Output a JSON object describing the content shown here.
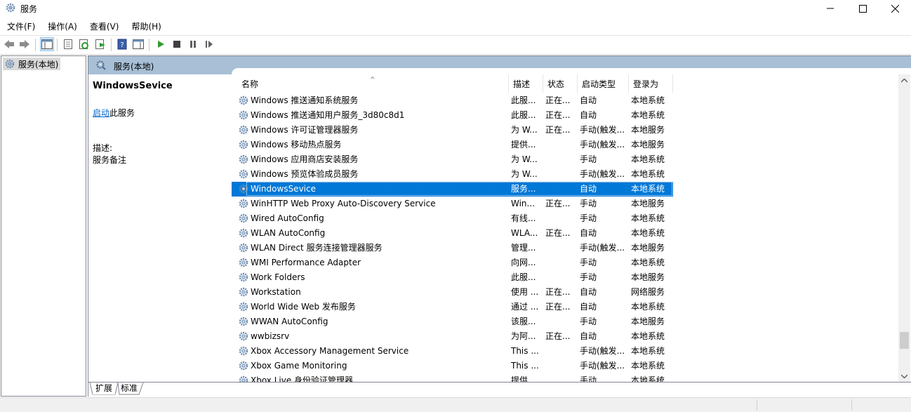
{
  "window": {
    "title": "服务"
  },
  "menu": [
    "文件(F)",
    "操作(A)",
    "查看(V)",
    "帮助(H)"
  ],
  "tree": {
    "root_label": "服务(本地)"
  },
  "pane_header": "服务(本地)",
  "extended": {
    "service_name": "WindowsSevice",
    "start_link": "启动",
    "start_suffix": "此服务",
    "desc_label": "描述:",
    "desc_value": "服务备注"
  },
  "columns": {
    "name": "名称",
    "description": "描述",
    "status": "状态",
    "startup": "启动类型",
    "logon": "登录为"
  },
  "services": [
    {
      "name": "Windows 推送通知系统服务",
      "description": "此服...",
      "status": "正在...",
      "startup": "自动",
      "logon": "本地系统"
    },
    {
      "name": "Windows 推送通知用户服务_3d80c8d1",
      "description": "此服...",
      "status": "正在...",
      "startup": "自动",
      "logon": "本地系统"
    },
    {
      "name": "Windows 许可证管理器服务",
      "description": "为 W...",
      "status": "正在...",
      "startup": "手动(触发...",
      "logon": "本地服务"
    },
    {
      "name": "Windows 移动热点服务",
      "description": "提供...",
      "status": "",
      "startup": "手动(触发...",
      "logon": "本地服务"
    },
    {
      "name": "Windows 应用商店安装服务",
      "description": "为 W...",
      "status": "",
      "startup": "手动",
      "logon": "本地系统"
    },
    {
      "name": "Windows 预览体验成员服务",
      "description": "为 W...",
      "status": "",
      "startup": "手动(触发...",
      "logon": "本地系统"
    },
    {
      "name": "WindowsSevice",
      "description": "服务...",
      "status": "",
      "startup": "自动",
      "logon": "本地系统",
      "selected": true
    },
    {
      "name": "WinHTTP Web Proxy Auto-Discovery Service",
      "description": "Win...",
      "status": "正在...",
      "startup": "手动",
      "logon": "本地服务"
    },
    {
      "name": "Wired AutoConfig",
      "description": "有线...",
      "status": "",
      "startup": "手动",
      "logon": "本地系统"
    },
    {
      "name": "WLAN AutoConfig",
      "description": "WLA...",
      "status": "正在...",
      "startup": "自动",
      "logon": "本地系统"
    },
    {
      "name": "WLAN Direct 服务连接管理器服务",
      "description": "管理...",
      "status": "",
      "startup": "手动(触发...",
      "logon": "本地服务"
    },
    {
      "name": "WMI Performance Adapter",
      "description": "向网...",
      "status": "",
      "startup": "手动",
      "logon": "本地系统"
    },
    {
      "name": "Work Folders",
      "description": "此服...",
      "status": "",
      "startup": "手动",
      "logon": "本地服务"
    },
    {
      "name": "Workstation",
      "description": "使用 ...",
      "status": "正在...",
      "startup": "自动",
      "logon": "网络服务"
    },
    {
      "name": "World Wide Web 发布服务",
      "description": "通过 ...",
      "status": "正在...",
      "startup": "自动",
      "logon": "本地系统"
    },
    {
      "name": "WWAN AutoConfig",
      "description": "该服...",
      "status": "",
      "startup": "手动",
      "logon": "本地服务"
    },
    {
      "name": "wwbizsrv",
      "description": "为阿...",
      "status": "正在...",
      "startup": "自动",
      "logon": "本地系统"
    },
    {
      "name": "Xbox Accessory Management Service",
      "description": "This ...",
      "status": "",
      "startup": "手动(触发...",
      "logon": "本地系统"
    },
    {
      "name": "Xbox Game Monitoring",
      "description": "This ...",
      "status": "",
      "startup": "手动(触发...",
      "logon": "本地系统"
    },
    {
      "name": "Xbox Live 身份验证管理器",
      "description": "提供 ...",
      "status": "",
      "startup": "手动",
      "logon": "本地系统"
    }
  ],
  "tabs": [
    "扩展",
    "标准"
  ],
  "accent": "#0078d7",
  "header_band_color": "#a8bfd6"
}
